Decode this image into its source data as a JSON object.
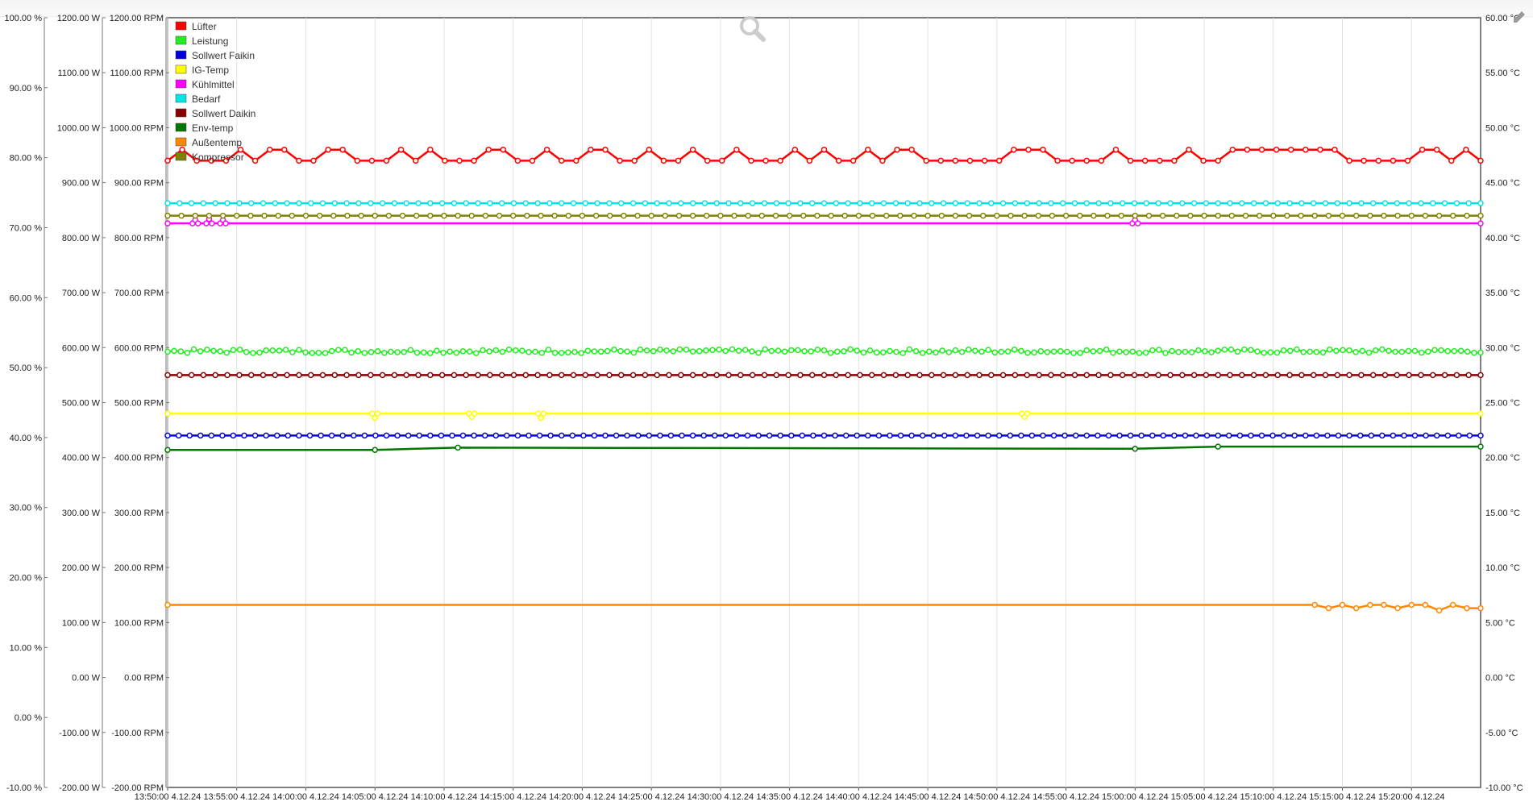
{
  "chart_data": {
    "type": "line",
    "title": "",
    "grid": true,
    "legend_placement": "top-left",
    "x_ticks": [
      "13:50:00 4.12.24",
      "13:55:00 4.12.24",
      "14:00:00 4.12.24",
      "14:05:00 4.12.24",
      "14:10:00 4.12.24",
      "14:15:00 4.12.24",
      "14:20:00 4.12.24",
      "14:25:00 4.12.24",
      "14:30:00 4.12.24",
      "14:35:00 4.12.24",
      "14:40:00 4.12.24",
      "14:45:00 4.12.24",
      "14:50:00 4.12.24",
      "14:55:00 4.12.24",
      "15:00:00 4.12.24",
      "15:05:00 4.12.24",
      "15:10:00 4.12.24",
      "15:15:00 4.12.24",
      "15:20:00 4.12.24"
    ],
    "x_range": [
      "13:50:00 4.12.24",
      "15:25:00 4.12.24"
    ],
    "axes": [
      {
        "id": "pct",
        "side": "left",
        "range": [
          -10,
          100
        ],
        "ticks": [
          "100.00 %",
          "90.00 %",
          "80.00 %",
          "70.00 %",
          "60.00 %",
          "50.00 %",
          "40.00 %",
          "30.00 %",
          "20.00 %",
          "10.00 %",
          "0.00 %",
          "-10.00 %"
        ]
      },
      {
        "id": "watt",
        "side": "left",
        "range": [
          -200,
          1200
        ],
        "ticks": [
          "1200.00 W",
          "1100.00 W",
          "1000.00 W",
          "900.00 W",
          "800.00 W",
          "700.00 W",
          "600.00 W",
          "500.00 W",
          "400.00 W",
          "300.00 W",
          "200.00 W",
          "100.00 W",
          "0.00 W",
          "-100.00 W",
          "-200.00 W"
        ]
      },
      {
        "id": "rpm",
        "side": "left",
        "range": [
          -200,
          1200
        ],
        "ticks": [
          "1200.00 RPM",
          "1100.00 RPM",
          "1000.00 RPM",
          "900.00 RPM",
          "800.00 RPM",
          "700.00 RPM",
          "600.00 RPM",
          "500.00 RPM",
          "400.00 RPM",
          "300.00 RPM",
          "200.00 RPM",
          "100.00 RPM",
          "0.00 RPM",
          "-100.00 RPM",
          "-200.00 RPM"
        ]
      },
      {
        "id": "temp",
        "side": "right",
        "range": [
          -10,
          60
        ],
        "ticks": [
          "60.00 °C",
          "55.00 °C",
          "50.00 °C",
          "45.00 °C",
          "40.00 °C",
          "35.00 °C",
          "30.00 °C",
          "25.00 °C",
          "20.00 °C",
          "15.00 °C",
          "10.00 °C",
          "5.00 °C",
          "0.00 °C",
          "-5.00 °C",
          "-10.00 °C"
        ]
      }
    ],
    "series": [
      {
        "name": "Lüfter",
        "color": "#ff0000",
        "axis": "rpm",
        "base": 940,
        "alt": 960,
        "jitter": "steps",
        "dense": 90
      },
      {
        "name": "Leistung",
        "color": "#22ee22",
        "axis": "watt",
        "base": 590,
        "alt": 597,
        "jitter": "noise",
        "dense": 200
      },
      {
        "name": "Sollwert Faikin",
        "color": "#0000dd",
        "axis": "temp",
        "base": 22,
        "dense": 120
      },
      {
        "name": "IG-Temp",
        "color": "#ffff00",
        "axis": "temp",
        "base": 24,
        "dense": 0,
        "dips": [
          [
            "14:05",
            23.6
          ],
          [
            "14:12",
            23.7
          ],
          [
            "14:17",
            23.6
          ],
          [
            "14:52",
            23.7
          ]
        ]
      },
      {
        "name": "Kühlmittel",
        "color": "#ff00ff",
        "axis": "temp",
        "base": 41.3,
        "dense": 0,
        "dips": [
          [
            "13:52",
            41.6
          ],
          [
            "13:53",
            41.7
          ],
          [
            "13:54",
            41.6
          ],
          [
            "15:00",
            41.6
          ]
        ]
      },
      {
        "name": "Bedarf",
        "color": "#00e5e5",
        "axis": "pct",
        "base": 73.5,
        "dense": 110
      },
      {
        "name": "Sollwert Daikin",
        "color": "#880000",
        "axis": "rpm",
        "base": 550,
        "dense": 110
      },
      {
        "name": "Env-temp",
        "color": "#007700",
        "axis": "temp",
        "points": [
          [
            "13:50",
            20.7
          ],
          [
            "14:05",
            20.7
          ],
          [
            "14:11",
            20.9
          ],
          [
            "15:00",
            20.8
          ],
          [
            "15:06",
            21.0
          ],
          [
            "15:25",
            21.0
          ]
        ]
      },
      {
        "name": "Außentemp",
        "color": "#ff8800",
        "axis": "temp",
        "base": 6.6,
        "dense": 0,
        "tail": [
          [
            "15:13",
            6.6
          ],
          [
            "15:14",
            6.3
          ],
          [
            "15:15",
            6.6
          ],
          [
            "15:16",
            6.3
          ],
          [
            "15:17",
            6.6
          ],
          [
            "15:18",
            6.6
          ],
          [
            "15:19",
            6.3
          ],
          [
            "15:20",
            6.6
          ],
          [
            "15:21",
            6.6
          ],
          [
            "15:22",
            6.1
          ],
          [
            "15:23",
            6.6
          ],
          [
            "15:24",
            6.3
          ],
          [
            "15:25",
            6.3
          ]
        ]
      },
      {
        "name": "Kompressor",
        "color": "#808000",
        "axis": "rpm",
        "base": 840,
        "dense": 95
      }
    ]
  }
}
